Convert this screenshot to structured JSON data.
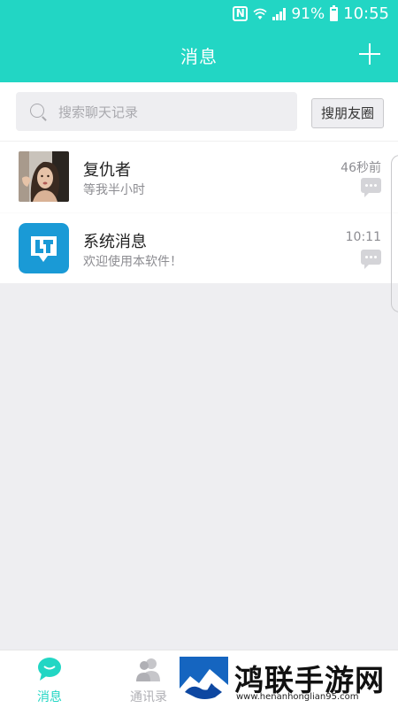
{
  "status_bar": {
    "nfc_icon": "N",
    "battery_percent": "91%",
    "time": "10:55"
  },
  "header": {
    "title": "消息",
    "add_icon": "plus-icon",
    "color": "#22d6c4"
  },
  "search": {
    "placeholder": "搜索聊天记录",
    "search_friends_button": "搜朋友圈"
  },
  "chats": [
    {
      "name": "复仇者",
      "preview": "等我半小时",
      "time": "46秒前",
      "avatar": "user-photo"
    },
    {
      "name": "系统消息",
      "preview": "欢迎使用本软件！",
      "time": "10:11",
      "avatar": "system-app-logo"
    }
  ],
  "bottom_nav": {
    "items": [
      {
        "label": "消息",
        "icon": "chat-bubble-icon",
        "active": true,
        "color": "#22d6c4"
      },
      {
        "label": "通讯录",
        "icon": "contacts-icon",
        "active": false,
        "color": "#b0b0b5"
      }
    ]
  },
  "watermark": {
    "title": "鸿联手游网",
    "url": "www.henanhonglian95.com"
  }
}
